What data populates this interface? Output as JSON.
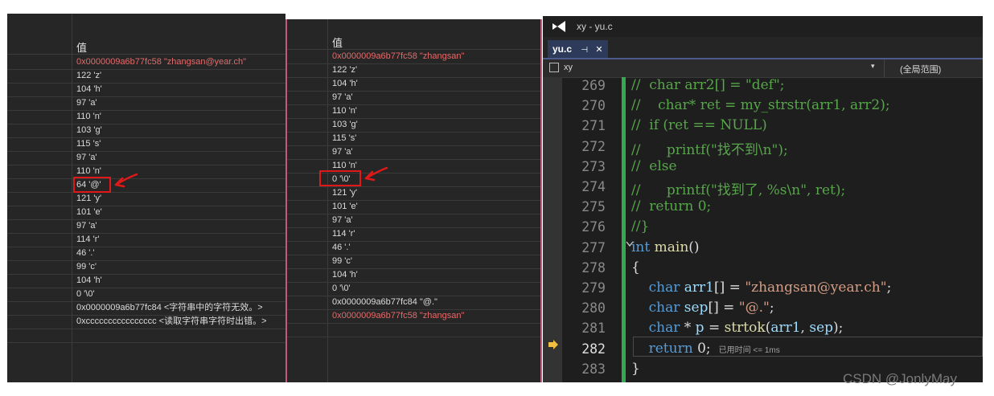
{
  "watch_left": {
    "header": "值",
    "rows": [
      "0x0000009a6b77fc58 \"zhangsan@year.ch\"",
      "122 'z'",
      "104 'h'",
      "97 'a'",
      "110 'n'",
      "103 'g'",
      "115 's'",
      "97 'a'",
      "110 'n'",
      "64 '@'",
      "121 'y'",
      "101 'e'",
      "97 'a'",
      "114 'r'",
      "46 '.'",
      "99 'c'",
      "104 'h'",
      "0 '\\0'",
      "0x0000009a6b77fc84 <字符串中的字符无效。>",
      "0xcccccccccccccccc <读取字符串字符时出错。>"
    ]
  },
  "watch_right": {
    "header": "值",
    "rows": [
      "0x0000009a6b77fc58 \"zhangsan\"",
      "122 'z'",
      "104 'h'",
      "97 'a'",
      "110 'n'",
      "103 'g'",
      "115 's'",
      "97 'a'",
      "110 'n'",
      "0 '\\0'",
      "121 'y'",
      "101 'e'",
      "97 'a'",
      "114 'r'",
      "46 '.'",
      "99 'c'",
      "104 'h'",
      "0 '\\0'",
      "0x0000009a6b77fc84 \"@.\"",
      "0x0000009a6b77fc58 \"zhangsan\""
    ]
  },
  "editor": {
    "window_title": "xy - yu.c",
    "tab_label": "yu.c",
    "tab_pin": "⊣",
    "tab_close": "✕",
    "project": "xy",
    "scope": "(全局范围)",
    "exec_hint": "已用时间 <= 1ms",
    "line_numbers": [
      "269",
      "270",
      "271",
      "272",
      "273",
      "274",
      "275",
      "276",
      "277",
      "278",
      "279",
      "280",
      "281",
      "282",
      "283"
    ],
    "lines": [
      "//  char arr2[] = \"def\";",
      "//    char* ret = my_strstr(arr1, arr2);",
      "//  if (ret == NULL)",
      "//      printf(\"找不到\\n\");",
      "//  else",
      "//      printf(\"找到了, %s\\n\", ret);",
      "//  return 0;",
      "//}",
      "int main()",
      "{",
      "    char arr1[] = \"zhangsan@year.ch\";",
      "    char sep[] = \"@.\";",
      "    char * p = strtok(arr1, sep);",
      "    return 0;",
      "}"
    ]
  },
  "watermark": "CSDN @JonlyMay",
  "colors": {
    "keyword": "#569cd6",
    "function": "#dcdcaa",
    "string": "#d69d85",
    "comment": "#57a64a",
    "annotation": "#e01818"
  }
}
